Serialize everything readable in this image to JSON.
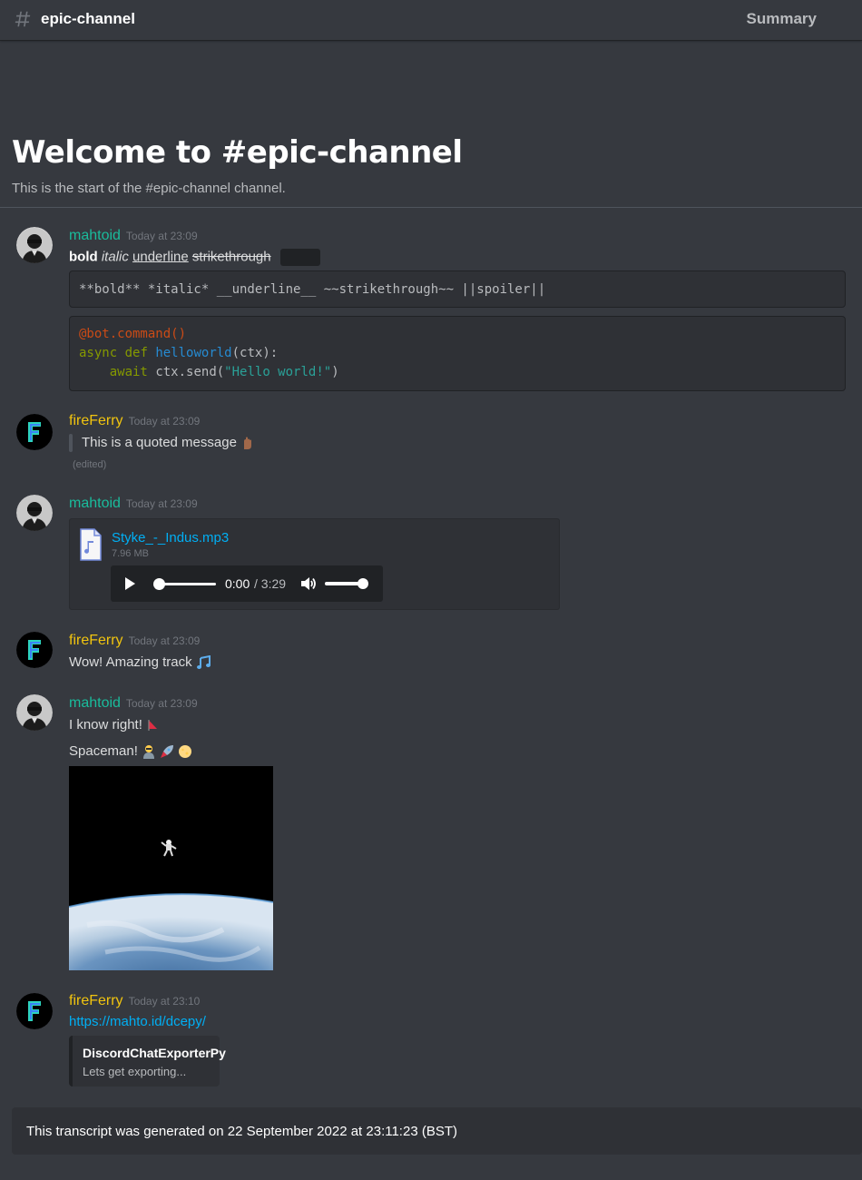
{
  "header": {
    "channel_name": "epic-channel",
    "summary_label": "Summary"
  },
  "welcome": {
    "title": "Welcome to #epic-channel",
    "subtitle": "This is the start of the #epic-channel channel."
  },
  "messages": [
    {
      "author": "mahtoid",
      "author_color": "#1abc9c",
      "time": "Today at 23:09",
      "rich_text": {
        "bold": "bold",
        "italic": "italic",
        "underline": "underline",
        "strike": "strikethrough"
      },
      "code_inline": "**bold** *italic* __underline__ ~~strikethrough~~ ||spoiler||",
      "code": {
        "decorator": "@bot.command()",
        "kw_async": "async",
        "kw_def": "def",
        "fn_name": "helloworld",
        "args": "(ctx):",
        "kw_await": "await",
        "call": "ctx.send(",
        "string": "\"Hello world!\"",
        "close": ")"
      }
    },
    {
      "author": "fireFerry",
      "author_color": "#f1c40f",
      "time": "Today at 23:09",
      "quote": "This is a quoted message",
      "edited": "(edited)"
    },
    {
      "author": "mahtoid",
      "author_color": "#1abc9c",
      "time": "Today at 23:09",
      "attachment": {
        "file_name": "Styke_-_Indus.mp3",
        "file_size": "7.96 MB",
        "time_current": "0:00",
        "time_total": "/ 3:29",
        "playback_progress": 0,
        "volume_level": 1
      }
    },
    {
      "author": "fireFerry",
      "author_color": "#f1c40f",
      "time": "Today at 23:09",
      "text": "Wow! Amazing track"
    },
    {
      "author": "mahtoid",
      "author_color": "#1abc9c",
      "time": "Today at 23:09",
      "text1": "I know right!",
      "text2": "Spaceman!"
    },
    {
      "author": "fireFerry",
      "author_color": "#f1c40f",
      "time": "Today at 23:10",
      "link": "https://mahto.id/dcepy/",
      "embed": {
        "title": "DiscordChatExporterPy",
        "description": "Lets get exporting..."
      }
    }
  ],
  "footer": {
    "text": "This transcript was generated on 22 September 2022 at 23:11:23 (BST)"
  },
  "colors": {
    "background": "#36393f",
    "link": "#00aff4",
    "teal": "#1abc9c",
    "yellow": "#f1c40f"
  },
  "icons": [
    "hash-icon",
    "avatar-mahtoid",
    "avatar-fireferry",
    "audio-file-icon",
    "play-icon",
    "volume-icon",
    "raised-hand-emoji",
    "music-notes-emoji",
    "triangle-flag-emoji",
    "astronaut-emoji",
    "rocket-emoji",
    "moon-emoji"
  ]
}
